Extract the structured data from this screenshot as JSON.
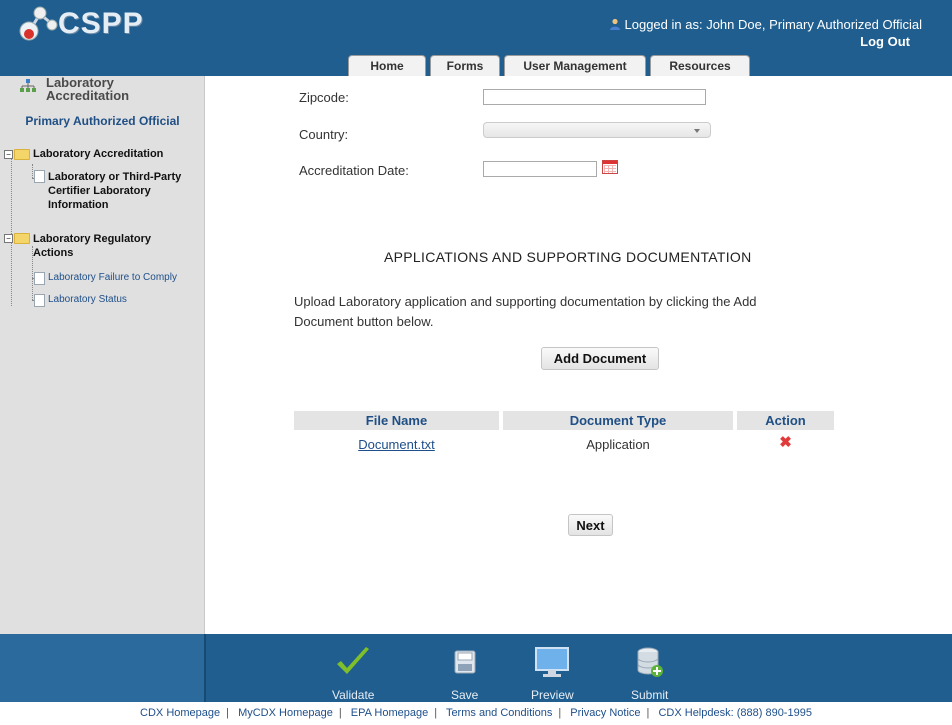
{
  "header": {
    "logo_text": "CSPP",
    "login_text": "Logged in as: John Doe, Primary Authorized Official",
    "logout_label": "Log Out",
    "tabs": [
      "Home",
      "Forms",
      "User Management",
      "Resources"
    ]
  },
  "sidebar": {
    "title_line1": "Laboratory",
    "title_line2": "Accreditation",
    "role": "Primary Authorized Official",
    "tree": {
      "group1": "Laboratory Accreditation",
      "group1_child_line1": "Laboratory or Third-Party",
      "group1_child_line2": "Certifier Laboratory",
      "group1_child_line3": "Information",
      "group2_line1": "Laboratory Regulatory",
      "group2_line2": "Actions",
      "group2_children": [
        "Laboratory Failure to Comply",
        "Laboratory Status"
      ]
    }
  },
  "form": {
    "zipcode_label": "Zipcode:",
    "zipcode_value": "",
    "country_label": "Country:",
    "country_value": "",
    "accreditation_label": "Accreditation Date:",
    "accreditation_value": ""
  },
  "documents": {
    "section_title": "APPLICATIONS AND SUPPORTING DOCUMENTATION",
    "instructions": "Upload Laboratory application and supporting documentation by clicking the Add Document button below.",
    "add_button": "Add Document",
    "columns": [
      "File Name",
      "Document Type",
      "Action"
    ],
    "rows": [
      {
        "file_name": "Document.txt",
        "document_type": "Application"
      }
    ],
    "next_button": "Next"
  },
  "actions": [
    "Validate",
    "Save",
    "Preview",
    "Submit"
  ],
  "footer": {
    "links": [
      "CDX Homepage",
      "MyCDX Homepage",
      "EPA Homepage",
      "Terms and Conditions",
      "Privacy Notice",
      "CDX Helpdesk: (888) 890-1995"
    ]
  },
  "colors": {
    "header_bg": "#1f5e8f",
    "link": "#1e4f8a",
    "delete": "#e23a3a",
    "validate_check": "#7fbf2a"
  }
}
